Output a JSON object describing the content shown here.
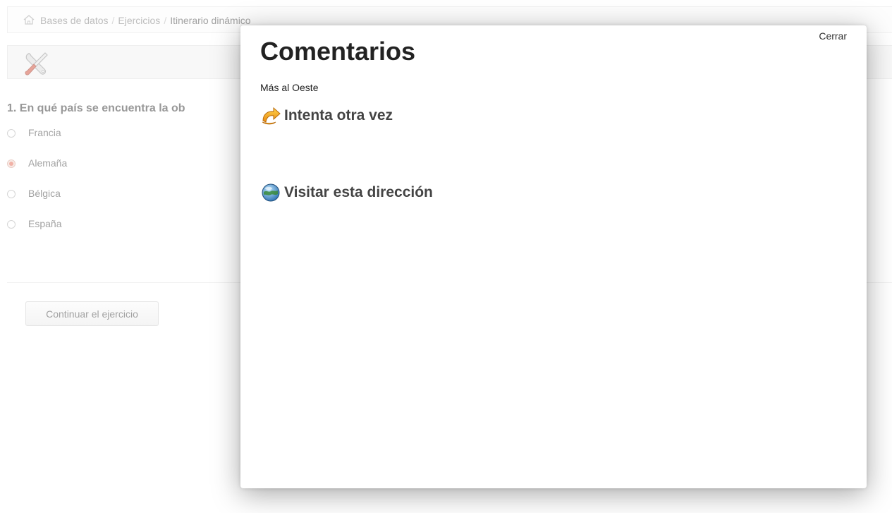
{
  "breadcrumb": {
    "items": [
      "Bases de datos",
      "Ejercicios"
    ],
    "current": "Itinerario dinámico",
    "separator": "/"
  },
  "question": {
    "title": "1. En qué país se encuentra la ob",
    "answers": [
      {
        "label": "Francia",
        "selected": false
      },
      {
        "label": "Alemaña",
        "selected": true
      },
      {
        "label": "Bélgica",
        "selected": false
      },
      {
        "label": "España",
        "selected": false
      }
    ]
  },
  "actions": {
    "continue_label": "Continuar el ejercicio"
  },
  "modal": {
    "close_label": "Cerrar",
    "title": "Comentarios",
    "subtitle": "Más al Oeste",
    "retry_label": "Intenta otra vez",
    "visit_label": "Visitar esta dirección"
  },
  "icons": {
    "home": "home-icon",
    "tools": "tools-icon",
    "retry": "retry-icon",
    "globe": "globe-icon"
  },
  "colors": {
    "radio_selected": "#e57360",
    "retry_icon": "#f0a020",
    "globe_icon": "#3c7fb8"
  }
}
